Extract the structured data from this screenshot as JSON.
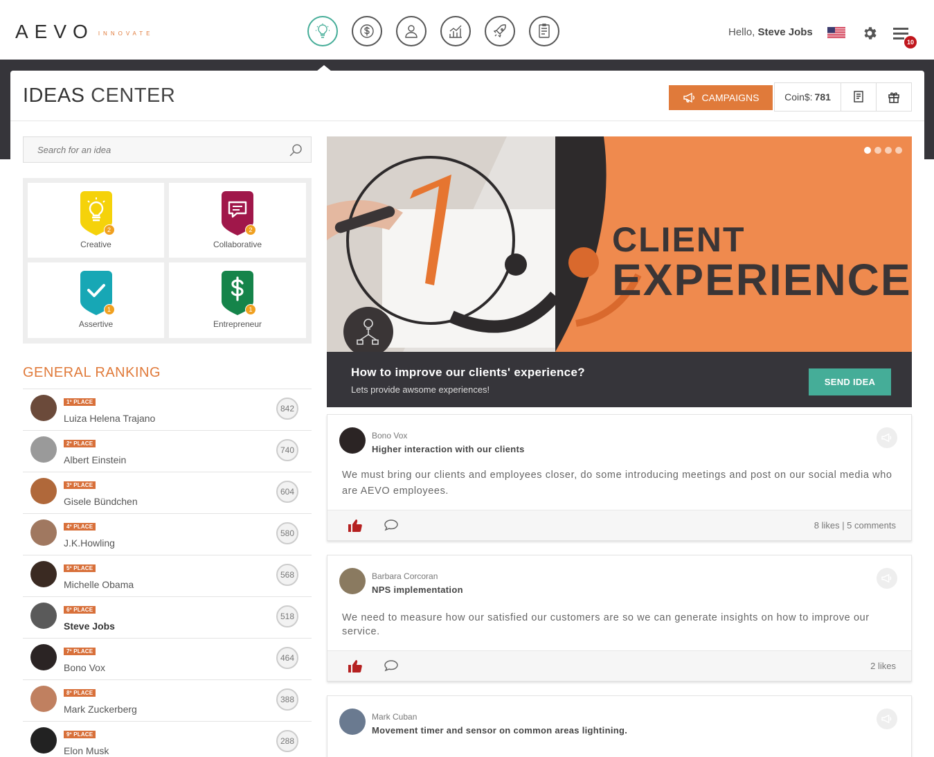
{
  "header": {
    "logo_text": "AEVO",
    "logo_sub": "INNOVATE",
    "nav_icons": [
      "lightbulb-icon",
      "dollar-icon",
      "user-icon",
      "chart-icon",
      "rocket-icon",
      "document-icon"
    ],
    "greeting": "Hello, ",
    "user_name": "Steve Jobs",
    "notifications_count": "10"
  },
  "page": {
    "title_bold": "IDEAS",
    "title_rest": " CENTER",
    "campaigns_label": "CAMPAIGNS",
    "coins_label": "Coin$:",
    "coins_value": "781"
  },
  "search": {
    "placeholder": "Search for an idea"
  },
  "badges": [
    {
      "label": "Creative",
      "count": "2",
      "color": "#f5d20a",
      "icon": "lightbulb-icon"
    },
    {
      "label": "Collaborative",
      "count": "2",
      "color": "#a0174a",
      "icon": "chat-icon"
    },
    {
      "label": "Assertive",
      "count": "1",
      "color": "#17a7b5",
      "icon": "check-icon"
    },
    {
      "label": "Entrepreneur",
      "count": "1",
      "color": "#15844a",
      "icon": "dollar-icon"
    }
  ],
  "ranking": {
    "title": "GENERAL RANKING",
    "rows": [
      {
        "place": "1º PLACE",
        "name": "Luiza Helena Trajano",
        "score": "842"
      },
      {
        "place": "2º PLACE",
        "name": "Albert Einstein",
        "score": "740"
      },
      {
        "place": "3º PLACE",
        "name": "Gisele Bündchen",
        "score": "604"
      },
      {
        "place": "4º PLACE",
        "name": "J.K.Howling",
        "score": "580"
      },
      {
        "place": "5º PLACE",
        "name": "Michelle Obama",
        "score": "568"
      },
      {
        "place": "6º PLACE",
        "name": "Steve Jobs",
        "score": "518"
      },
      {
        "place": "7º PLACE",
        "name": "Bono Vox",
        "score": "464"
      },
      {
        "place": "8º PLACE",
        "name": "Mark Zuckerberg",
        "score": "388"
      },
      {
        "place": "9º PLACE",
        "name": "Elon Musk",
        "score": "288"
      }
    ]
  },
  "banner": {
    "title_line1": "CLIENT",
    "title_line2": "EXPERIENCE",
    "question": "How to improve our clients' experience?",
    "subtitle": "Lets provide awsome experiences!",
    "send_label": "SEND IDEA"
  },
  "ideas": [
    {
      "author": "Bono Vox",
      "title": "Higher interaction with our clients",
      "body": "We must bring our clients and employees closer, do some introducing meetings and post on our social media who are AEVO employees.",
      "stats": "8 likes | 5 comments"
    },
    {
      "author": "Barbara Corcoran",
      "title": "NPS implementation",
      "body": "We need to measure how our satisfied our customers are so we can generate insights on how to improve our service.",
      "stats": "2 likes"
    },
    {
      "author": "Mark Cuban",
      "title": "Movement timer and sensor on common areas lightining.",
      "body": "",
      "stats": ""
    }
  ],
  "colors": {
    "accent_orange": "#e07a3a",
    "accent_teal": "#45ad98",
    "dark": "#36353a"
  }
}
